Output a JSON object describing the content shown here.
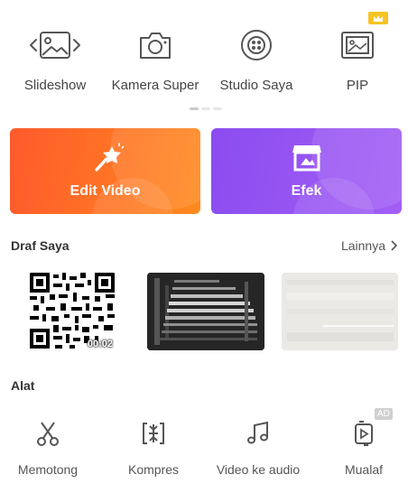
{
  "top_actions": [
    {
      "label": "Slideshow",
      "icon": "slideshow-icon"
    },
    {
      "label": "Kamera Super",
      "icon": "camera-icon"
    },
    {
      "label": "Studio Saya",
      "icon": "studio-icon"
    },
    {
      "label": "PIP",
      "icon": "pip-icon",
      "badge": "crown-icon"
    }
  ],
  "page_indicator": {
    "pages": 3,
    "active": 1
  },
  "cards": {
    "edit_video": {
      "label": "Edit Video",
      "icon": "magic-wand-icon",
      "color": "#ff6a26"
    },
    "efek": {
      "label": "Efek",
      "icon": "effects-store-icon",
      "color": "#9356f2"
    }
  },
  "drafts": {
    "title": "Draf Saya",
    "more_label": "Lainnya",
    "items": [
      {
        "duration": "00:02"
      },
      {
        "duration": ""
      },
      {
        "duration": ""
      }
    ]
  },
  "tools": {
    "title": "Alat",
    "items": [
      {
        "label": "Memotong",
        "icon": "scissors-icon"
      },
      {
        "label": "Kompres",
        "icon": "compress-icon"
      },
      {
        "label": "Video ke audio",
        "icon": "music-note-icon"
      },
      {
        "label": "Mualaf",
        "icon": "convert-video-icon"
      }
    ],
    "ad_label": "AD"
  }
}
